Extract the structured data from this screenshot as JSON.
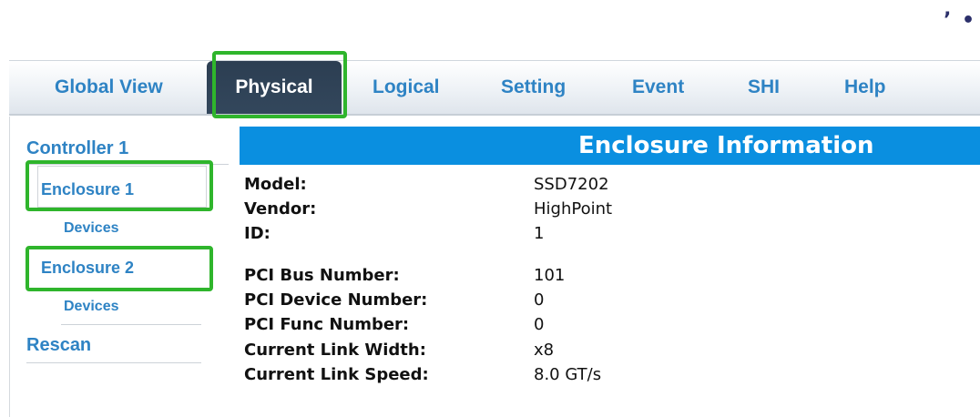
{
  "corner_text": "’ •",
  "tabs": {
    "global_view": "Global View",
    "physical": "Physical",
    "logical": "Logical",
    "setting": "Setting",
    "event": "Event",
    "shi": "SHI",
    "help": "Help"
  },
  "sidebar": {
    "controller": "Controller 1",
    "enclosure1": "Enclosure 1",
    "devices1": "Devices",
    "enclosure2": "Enclosure 2",
    "devices2": "Devices",
    "rescan": "Rescan"
  },
  "panel": {
    "title": "Enclosure Information",
    "rows": [
      {
        "label": "Model:",
        "value": "SSD7202"
      },
      {
        "label": "Vendor:",
        "value": "HighPoint"
      },
      {
        "label": "ID:",
        "value": "1"
      },
      {
        "label": "PCI Bus Number:",
        "value": "101"
      },
      {
        "label": "PCI Device Number:",
        "value": "0"
      },
      {
        "label": "PCI Func Number:",
        "value": "0"
      },
      {
        "label": "Current Link Width:",
        "value": "x8"
      },
      {
        "label": "Current Link Speed:",
        "value": "8.0 GT/s"
      }
    ]
  },
  "colors": {
    "accent_link": "#2e83c4",
    "header_blue": "#0a8fe0",
    "active_tab": "#2c3e52",
    "highlight_green": "#2fb52c"
  }
}
